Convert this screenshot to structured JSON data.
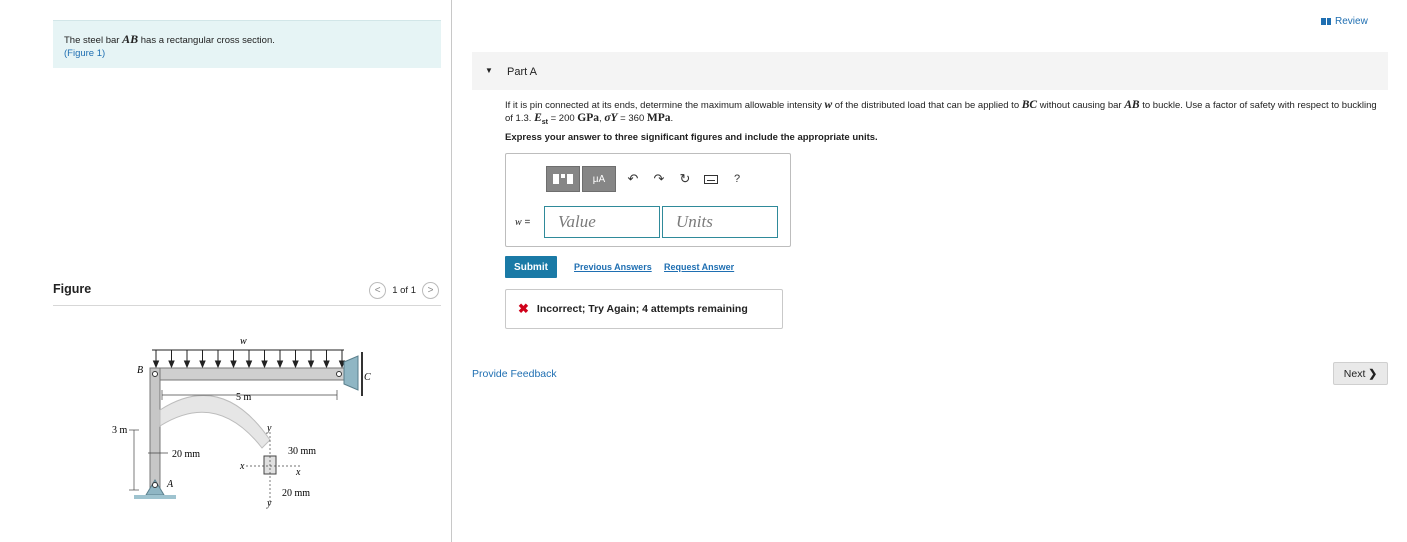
{
  "problem": {
    "text_prefix": "The steel bar ",
    "bar": "AB",
    "text_suffix": " has a rectangular cross section.",
    "figure_link": "(Figure 1)"
  },
  "figure": {
    "title": "Figure",
    "pager": "1 of 1",
    "prev_icon": "chevron-left-icon",
    "next_icon": "chevron-right-icon",
    "labels": {
      "w": "w",
      "B": "B",
      "C": "C",
      "A": "A",
      "span": "5 m",
      "height": "3 m",
      "d20a": "20 mm",
      "d30": "30 mm",
      "d20b": "20 mm",
      "x": "x",
      "x2": "x",
      "y": "y",
      "y2": "y"
    }
  },
  "review": {
    "label": "Review",
    "icon": "review-icon"
  },
  "part": {
    "toggle": "▼",
    "title": "Part A"
  },
  "question": {
    "p1": "If it is pin connected at its ends, determine the maximum allowable intensity ",
    "w": "w",
    "p2": " of the distributed load that can be applied to ",
    "bc": "BC",
    "p3": " without causing bar ",
    "ab": "AB",
    "p4": " to buckle. Use a factor of safety with respect to buckling of 1.3. ",
    "est": "E",
    "est_sub": "st",
    "p5": " = 200 ",
    "gpa": "GPa",
    "p6": ", ",
    "sigma": "σY",
    "p7": " = 360 ",
    "mpa": "MPa",
    "p8": "."
  },
  "instruction": "Express your answer to three significant figures and include the appropriate units.",
  "toolbar": {
    "templates_icon": "templates-icon",
    "units_label": "μA",
    "undo_icon": "undo-icon",
    "redo_icon": "redo-icon",
    "reset_icon": "reset-icon",
    "keyboard_icon": "keyboard-icon",
    "help": "?"
  },
  "answer": {
    "var": "w",
    "eq": " =",
    "value_placeholder": "Value",
    "units_placeholder": "Units"
  },
  "actions": {
    "submit": "Submit",
    "previous": "Previous Answers",
    "request": "Request Answer"
  },
  "feedback": {
    "icon": "x-icon",
    "text": "Incorrect; Try Again; 4 attempts remaining"
  },
  "provide_feedback": "Provide Feedback",
  "next": {
    "label": "Next",
    "icon": "chevron-right-icon"
  },
  "colors": {
    "link": "#1f6fb2",
    "submit": "#1a7aa6",
    "error": "#d0021b",
    "problem_bg": "#e6f4f5"
  }
}
